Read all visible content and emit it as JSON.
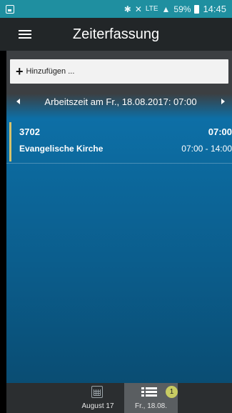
{
  "status_bar": {
    "signal_text": "LTE",
    "battery_percent": "59%",
    "time": "14:45"
  },
  "app_bar": {
    "title": "Zeiterfassung"
  },
  "actions": {
    "add_label": "Hinzufügen ..."
  },
  "date_nav": {
    "label": "Arbeitszeit am Fr., 18.08.2017: 07:00"
  },
  "entries": [
    {
      "id": "3702",
      "hours": "07:00",
      "name": "Evangelische Kirche",
      "range": "07:00 - 14:00"
    }
  ],
  "bottom_nav": {
    "month_label": "August 17",
    "day_label": "Fr., 18.08.",
    "day_badge": "1"
  },
  "colors": {
    "status_bar": "#1f8fa0",
    "app_bar": "#222628",
    "entry_accent": "#d7c36b",
    "badge": "#c8cc63"
  }
}
